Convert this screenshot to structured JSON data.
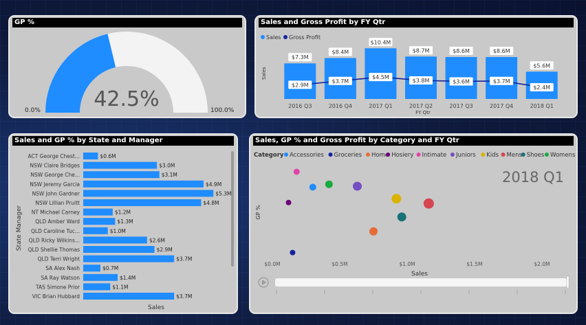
{
  "gauge": {
    "title": "GP %",
    "value_label": "42.5%",
    "value": 0.425,
    "min_label": "0.0%",
    "max_label": "100.0%",
    "fill_color": "#1f8cff",
    "track_color": "#f3f3f3"
  },
  "combo": {
    "title": "Sales and Gross Profit by FY Qtr",
    "legend": [
      {
        "name": "Sales",
        "color": "#1f8cff"
      },
      {
        "name": "Gross Profit",
        "color": "#12239e"
      }
    ],
    "ylabel": "Sales",
    "xlabel": "FY Qtr"
  },
  "bar": {
    "title": "Sales and GP % by State and Manager",
    "ylabel": "State Manager",
    "xlabel": "Sales"
  },
  "scatter": {
    "title": "Sales, GP % and Gross Profit by Category and FY Qtr",
    "legend_title": "Category",
    "period_label": "2018 Q1",
    "ylabel": "GP %",
    "xlabel": "Sales",
    "play_icon": "play-icon"
  },
  "chart_data": [
    {
      "type": "bar",
      "title": "Sales and Gross Profit by FY Qtr",
      "xlabel": "FY Qtr",
      "ylabel": "Sales",
      "categories": [
        "2016 Q3",
        "2016 Q4",
        "2017 Q1",
        "2017 Q2",
        "2017 Q3",
        "2017 Q4",
        "2018 Q1"
      ],
      "series": [
        {
          "name": "Sales",
          "type": "bar",
          "values": [
            7.3,
            8.4,
            10.4,
            8.7,
            8.6,
            8.6,
            5.6
          ],
          "labels": [
            "$7.3M",
            "$8.4M",
            "$10.4M",
            "$8.7M",
            "$8.6M",
            "$8.6M",
            "$5.6M"
          ],
          "color": "#1f8cff"
        },
        {
          "name": "Gross Profit",
          "type": "line",
          "values": [
            2.9,
            3.7,
            4.5,
            3.8,
            3.6,
            3.7,
            2.4
          ],
          "labels": [
            "$2.9M",
            "$3.7M",
            "$4.5M",
            "$3.8M",
            "$3.6M",
            "$3.7M",
            "$2.4M"
          ],
          "color": "#12239e"
        }
      ],
      "ylim": [
        0,
        11
      ]
    },
    {
      "type": "bar",
      "orientation": "horizontal",
      "title": "Sales and GP % by State and Manager",
      "xlabel": "Sales",
      "ylabel": "State Manager",
      "categories": [
        "ACT George Chest...",
        "NSW Claire Bridges",
        "NSW George Che...",
        "NSW Jeremy Garcia",
        "NSW John Gardner",
        "NSW Lillian Pruitt",
        "NT Michael Carney",
        "QLD Amber Ward",
        "QLD Caroline Tuc...",
        "QLD Ricky Wilkins...",
        "QLD Shellie Thomas",
        "QLD Terri Wright",
        "SA Alex Nash",
        "SA Ray Watson",
        "TAS Simone Prior",
        "VIC Brian Hubbard"
      ],
      "values": [
        0.6,
        3.0,
        3.1,
        4.9,
        5.3,
        4.8,
        1.2,
        1.3,
        1.0,
        2.6,
        2.9,
        3.7,
        0.7,
        1.4,
        1.1,
        3.7
      ],
      "labels": [
        "$0.6M",
        "$3.0M",
        "$3.1M",
        "$4.9M",
        "$5.3M",
        "$4.8M",
        "$1.2M",
        "$1.3M",
        "$1.0M",
        "$2.6M",
        "$2.9M",
        "$3.7M",
        "$0.7M",
        "$1.4M",
        "$1.1M",
        "$3.7M"
      ],
      "color": "#1f8cff",
      "xlim": [
        0,
        5.6
      ]
    },
    {
      "type": "scatter",
      "title": "Sales, GP % and Gross Profit by Category and FY Qtr",
      "xlabel": "Sales",
      "ylabel": "GP %",
      "x_ticks": [
        "$0.0M",
        "$0.5M",
        "$1.0M",
        "$1.5M",
        "$2.0M"
      ],
      "xlim": [
        0,
        2.1
      ],
      "ylim": [
        0,
        1
      ],
      "series": [
        {
          "name": "Accessories",
          "color": "#1f8cff",
          "x": 0.3,
          "y": 0.74,
          "size": 5
        },
        {
          "name": "Groceries",
          "color": "#12239e",
          "x": 0.15,
          "y": 0.06,
          "size": 4
        },
        {
          "name": "Home",
          "color": "#e66c37",
          "x": 0.75,
          "y": 0.28,
          "size": 6
        },
        {
          "name": "Hosiery",
          "color": "#6b007b",
          "x": 0.12,
          "y": 0.58,
          "size": 4
        },
        {
          "name": "Intimate",
          "color": "#e044a7",
          "x": 0.18,
          "y": 0.9,
          "size": 4.5
        },
        {
          "name": "Juniors",
          "color": "#744ec2",
          "x": 0.63,
          "y": 0.75,
          "size": 6.5
        },
        {
          "name": "Kids",
          "color": "#d9b300",
          "x": 0.92,
          "y": 0.62,
          "size": 7
        },
        {
          "name": "Mens",
          "color": "#d64550",
          "x": 1.16,
          "y": 0.57,
          "size": 7.5
        },
        {
          "name": "Shoes",
          "color": "#197278",
          "x": 0.96,
          "y": 0.43,
          "size": 6.5
        },
        {
          "name": "Womens",
          "color": "#1aab40",
          "x": 0.42,
          "y": 0.77,
          "size": 5.5
        }
      ]
    }
  ]
}
